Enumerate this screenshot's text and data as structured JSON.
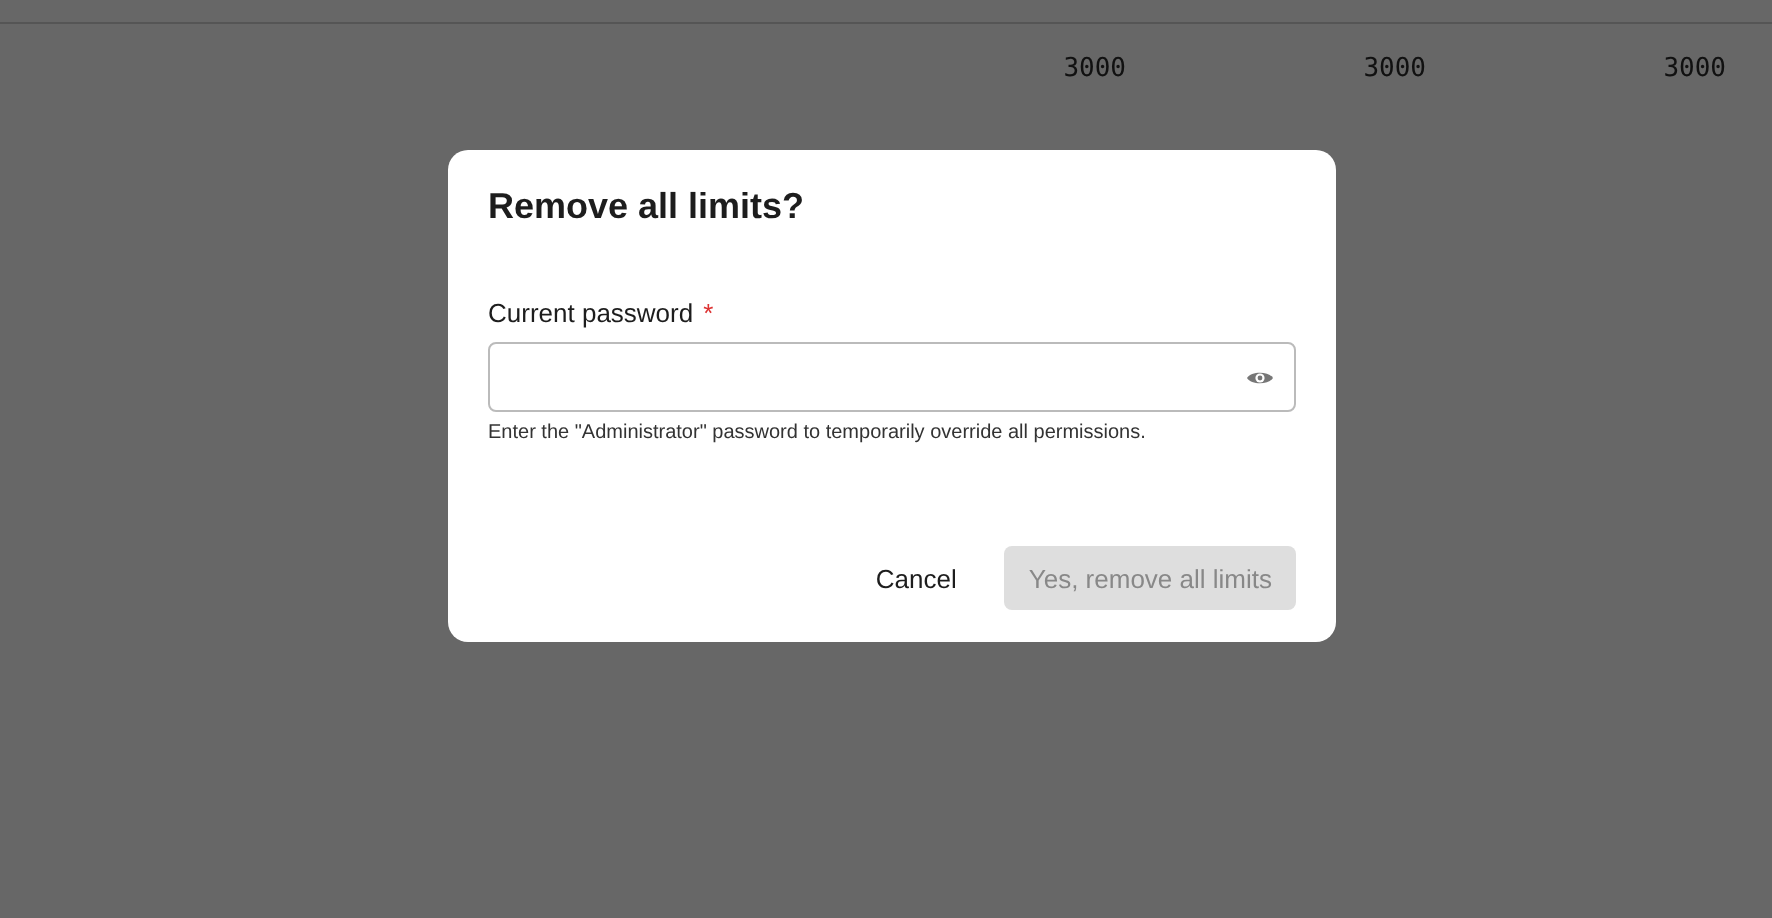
{
  "background_row": {
    "cells": [
      "3000",
      "3000",
      "3000"
    ]
  },
  "dialog": {
    "title": "Remove all limits?",
    "field": {
      "label": "Current password",
      "required_mark": "*",
      "help": "Enter the \"Administrator\" password to temporarily override all permissions."
    },
    "buttons": [
      {
        "label": "Cancel",
        "kind": "text",
        "disabled": false
      },
      {
        "label": "Yes, remove all limits",
        "kind": "primary",
        "disabled": true
      }
    ]
  }
}
